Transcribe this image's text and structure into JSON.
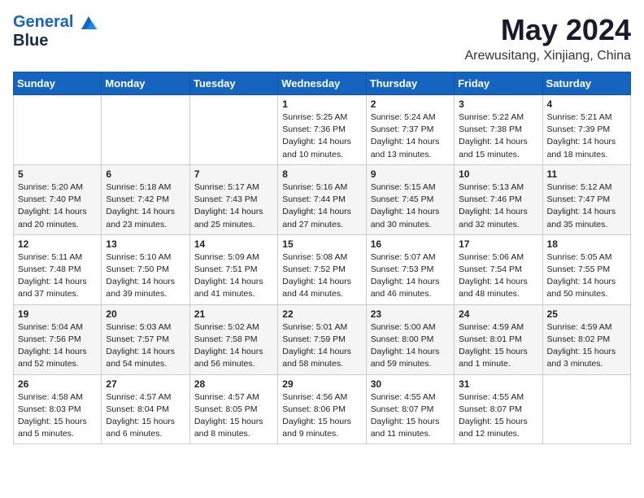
{
  "logo": {
    "line1": "General",
    "line2": "Blue"
  },
  "title": {
    "month_year": "May 2024",
    "location": "Arewusitang, Xinjiang, China"
  },
  "weekdays": [
    "Sunday",
    "Monday",
    "Tuesday",
    "Wednesday",
    "Thursday",
    "Friday",
    "Saturday"
  ],
  "weeks": [
    [
      {
        "day": "",
        "info": ""
      },
      {
        "day": "",
        "info": ""
      },
      {
        "day": "",
        "info": ""
      },
      {
        "day": "1",
        "info": "Sunrise: 5:25 AM\nSunset: 7:36 PM\nDaylight: 14 hours\nand 10 minutes."
      },
      {
        "day": "2",
        "info": "Sunrise: 5:24 AM\nSunset: 7:37 PM\nDaylight: 14 hours\nand 13 minutes."
      },
      {
        "day": "3",
        "info": "Sunrise: 5:22 AM\nSunset: 7:38 PM\nDaylight: 14 hours\nand 15 minutes."
      },
      {
        "day": "4",
        "info": "Sunrise: 5:21 AM\nSunset: 7:39 PM\nDaylight: 14 hours\nand 18 minutes."
      }
    ],
    [
      {
        "day": "5",
        "info": "Sunrise: 5:20 AM\nSunset: 7:40 PM\nDaylight: 14 hours\nand 20 minutes."
      },
      {
        "day": "6",
        "info": "Sunrise: 5:18 AM\nSunset: 7:42 PM\nDaylight: 14 hours\nand 23 minutes."
      },
      {
        "day": "7",
        "info": "Sunrise: 5:17 AM\nSunset: 7:43 PM\nDaylight: 14 hours\nand 25 minutes."
      },
      {
        "day": "8",
        "info": "Sunrise: 5:16 AM\nSunset: 7:44 PM\nDaylight: 14 hours\nand 27 minutes."
      },
      {
        "day": "9",
        "info": "Sunrise: 5:15 AM\nSunset: 7:45 PM\nDaylight: 14 hours\nand 30 minutes."
      },
      {
        "day": "10",
        "info": "Sunrise: 5:13 AM\nSunset: 7:46 PM\nDaylight: 14 hours\nand 32 minutes."
      },
      {
        "day": "11",
        "info": "Sunrise: 5:12 AM\nSunset: 7:47 PM\nDaylight: 14 hours\nand 35 minutes."
      }
    ],
    [
      {
        "day": "12",
        "info": "Sunrise: 5:11 AM\nSunset: 7:48 PM\nDaylight: 14 hours\nand 37 minutes."
      },
      {
        "day": "13",
        "info": "Sunrise: 5:10 AM\nSunset: 7:50 PM\nDaylight: 14 hours\nand 39 minutes."
      },
      {
        "day": "14",
        "info": "Sunrise: 5:09 AM\nSunset: 7:51 PM\nDaylight: 14 hours\nand 41 minutes."
      },
      {
        "day": "15",
        "info": "Sunrise: 5:08 AM\nSunset: 7:52 PM\nDaylight: 14 hours\nand 44 minutes."
      },
      {
        "day": "16",
        "info": "Sunrise: 5:07 AM\nSunset: 7:53 PM\nDaylight: 14 hours\nand 46 minutes."
      },
      {
        "day": "17",
        "info": "Sunrise: 5:06 AM\nSunset: 7:54 PM\nDaylight: 14 hours\nand 48 minutes."
      },
      {
        "day": "18",
        "info": "Sunrise: 5:05 AM\nSunset: 7:55 PM\nDaylight: 14 hours\nand 50 minutes."
      }
    ],
    [
      {
        "day": "19",
        "info": "Sunrise: 5:04 AM\nSunset: 7:56 PM\nDaylight: 14 hours\nand 52 minutes."
      },
      {
        "day": "20",
        "info": "Sunrise: 5:03 AM\nSunset: 7:57 PM\nDaylight: 14 hours\nand 54 minutes."
      },
      {
        "day": "21",
        "info": "Sunrise: 5:02 AM\nSunset: 7:58 PM\nDaylight: 14 hours\nand 56 minutes."
      },
      {
        "day": "22",
        "info": "Sunrise: 5:01 AM\nSunset: 7:59 PM\nDaylight: 14 hours\nand 58 minutes."
      },
      {
        "day": "23",
        "info": "Sunrise: 5:00 AM\nSunset: 8:00 PM\nDaylight: 14 hours\nand 59 minutes."
      },
      {
        "day": "24",
        "info": "Sunrise: 4:59 AM\nSunset: 8:01 PM\nDaylight: 15 hours\nand 1 minute."
      },
      {
        "day": "25",
        "info": "Sunrise: 4:59 AM\nSunset: 8:02 PM\nDaylight: 15 hours\nand 3 minutes."
      }
    ],
    [
      {
        "day": "26",
        "info": "Sunrise: 4:58 AM\nSunset: 8:03 PM\nDaylight: 15 hours\nand 5 minutes."
      },
      {
        "day": "27",
        "info": "Sunrise: 4:57 AM\nSunset: 8:04 PM\nDaylight: 15 hours\nand 6 minutes."
      },
      {
        "day": "28",
        "info": "Sunrise: 4:57 AM\nSunset: 8:05 PM\nDaylight: 15 hours\nand 8 minutes."
      },
      {
        "day": "29",
        "info": "Sunrise: 4:56 AM\nSunset: 8:06 PM\nDaylight: 15 hours\nand 9 minutes."
      },
      {
        "day": "30",
        "info": "Sunrise: 4:55 AM\nSunset: 8:07 PM\nDaylight: 15 hours\nand 11 minutes."
      },
      {
        "day": "31",
        "info": "Sunrise: 4:55 AM\nSunset: 8:07 PM\nDaylight: 15 hours\nand 12 minutes."
      },
      {
        "day": "",
        "info": ""
      }
    ]
  ]
}
